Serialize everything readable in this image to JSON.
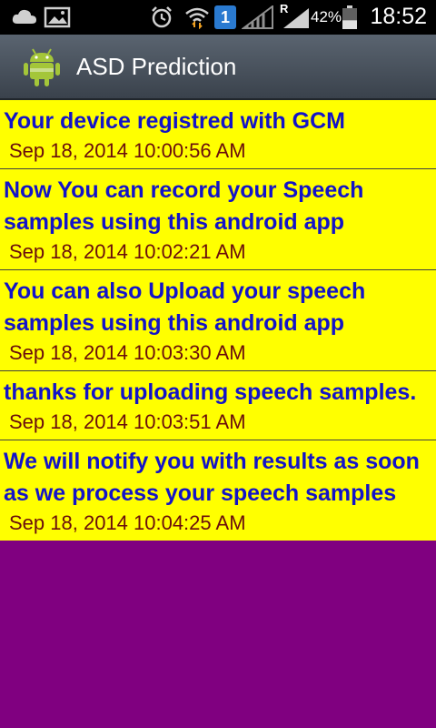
{
  "status_bar": {
    "icons": [
      "cloud-icon",
      "gallery-icon",
      "alarm-icon",
      "wifi-icon",
      "sim-icon",
      "signal-icon",
      "roaming-icon",
      "battery-icon"
    ],
    "sim_number": "1",
    "roaming_label": "R",
    "battery_percent": "42%",
    "battery_level": 0.42,
    "time": "18:52"
  },
  "action_bar": {
    "icon": "android-icon",
    "title": "ASD Prediction"
  },
  "colors": {
    "list_background": "#ffff00",
    "message_text": "#1313c8",
    "timestamp_text": "#6a0d0d",
    "empty_background": "#800080"
  },
  "messages": [
    {
      "text": "Your device registred with GCM",
      "time": "Sep 18, 2014 10:00:56 AM"
    },
    {
      "text": "Now You can record your Speech samples using this android app",
      "time": "Sep 18, 2014 10:02:21 AM"
    },
    {
      "text": "You can also Upload your speech samples using this android app",
      "time": "Sep 18, 2014 10:03:30 AM"
    },
    {
      "text": "thanks for uploading speech samples.",
      "time": "Sep 18, 2014 10:03:51 AM"
    },
    {
      "text": "We will notify you with results as soon as we process your speech samples",
      "time": "Sep 18, 2014 10:04:25 AM"
    }
  ]
}
